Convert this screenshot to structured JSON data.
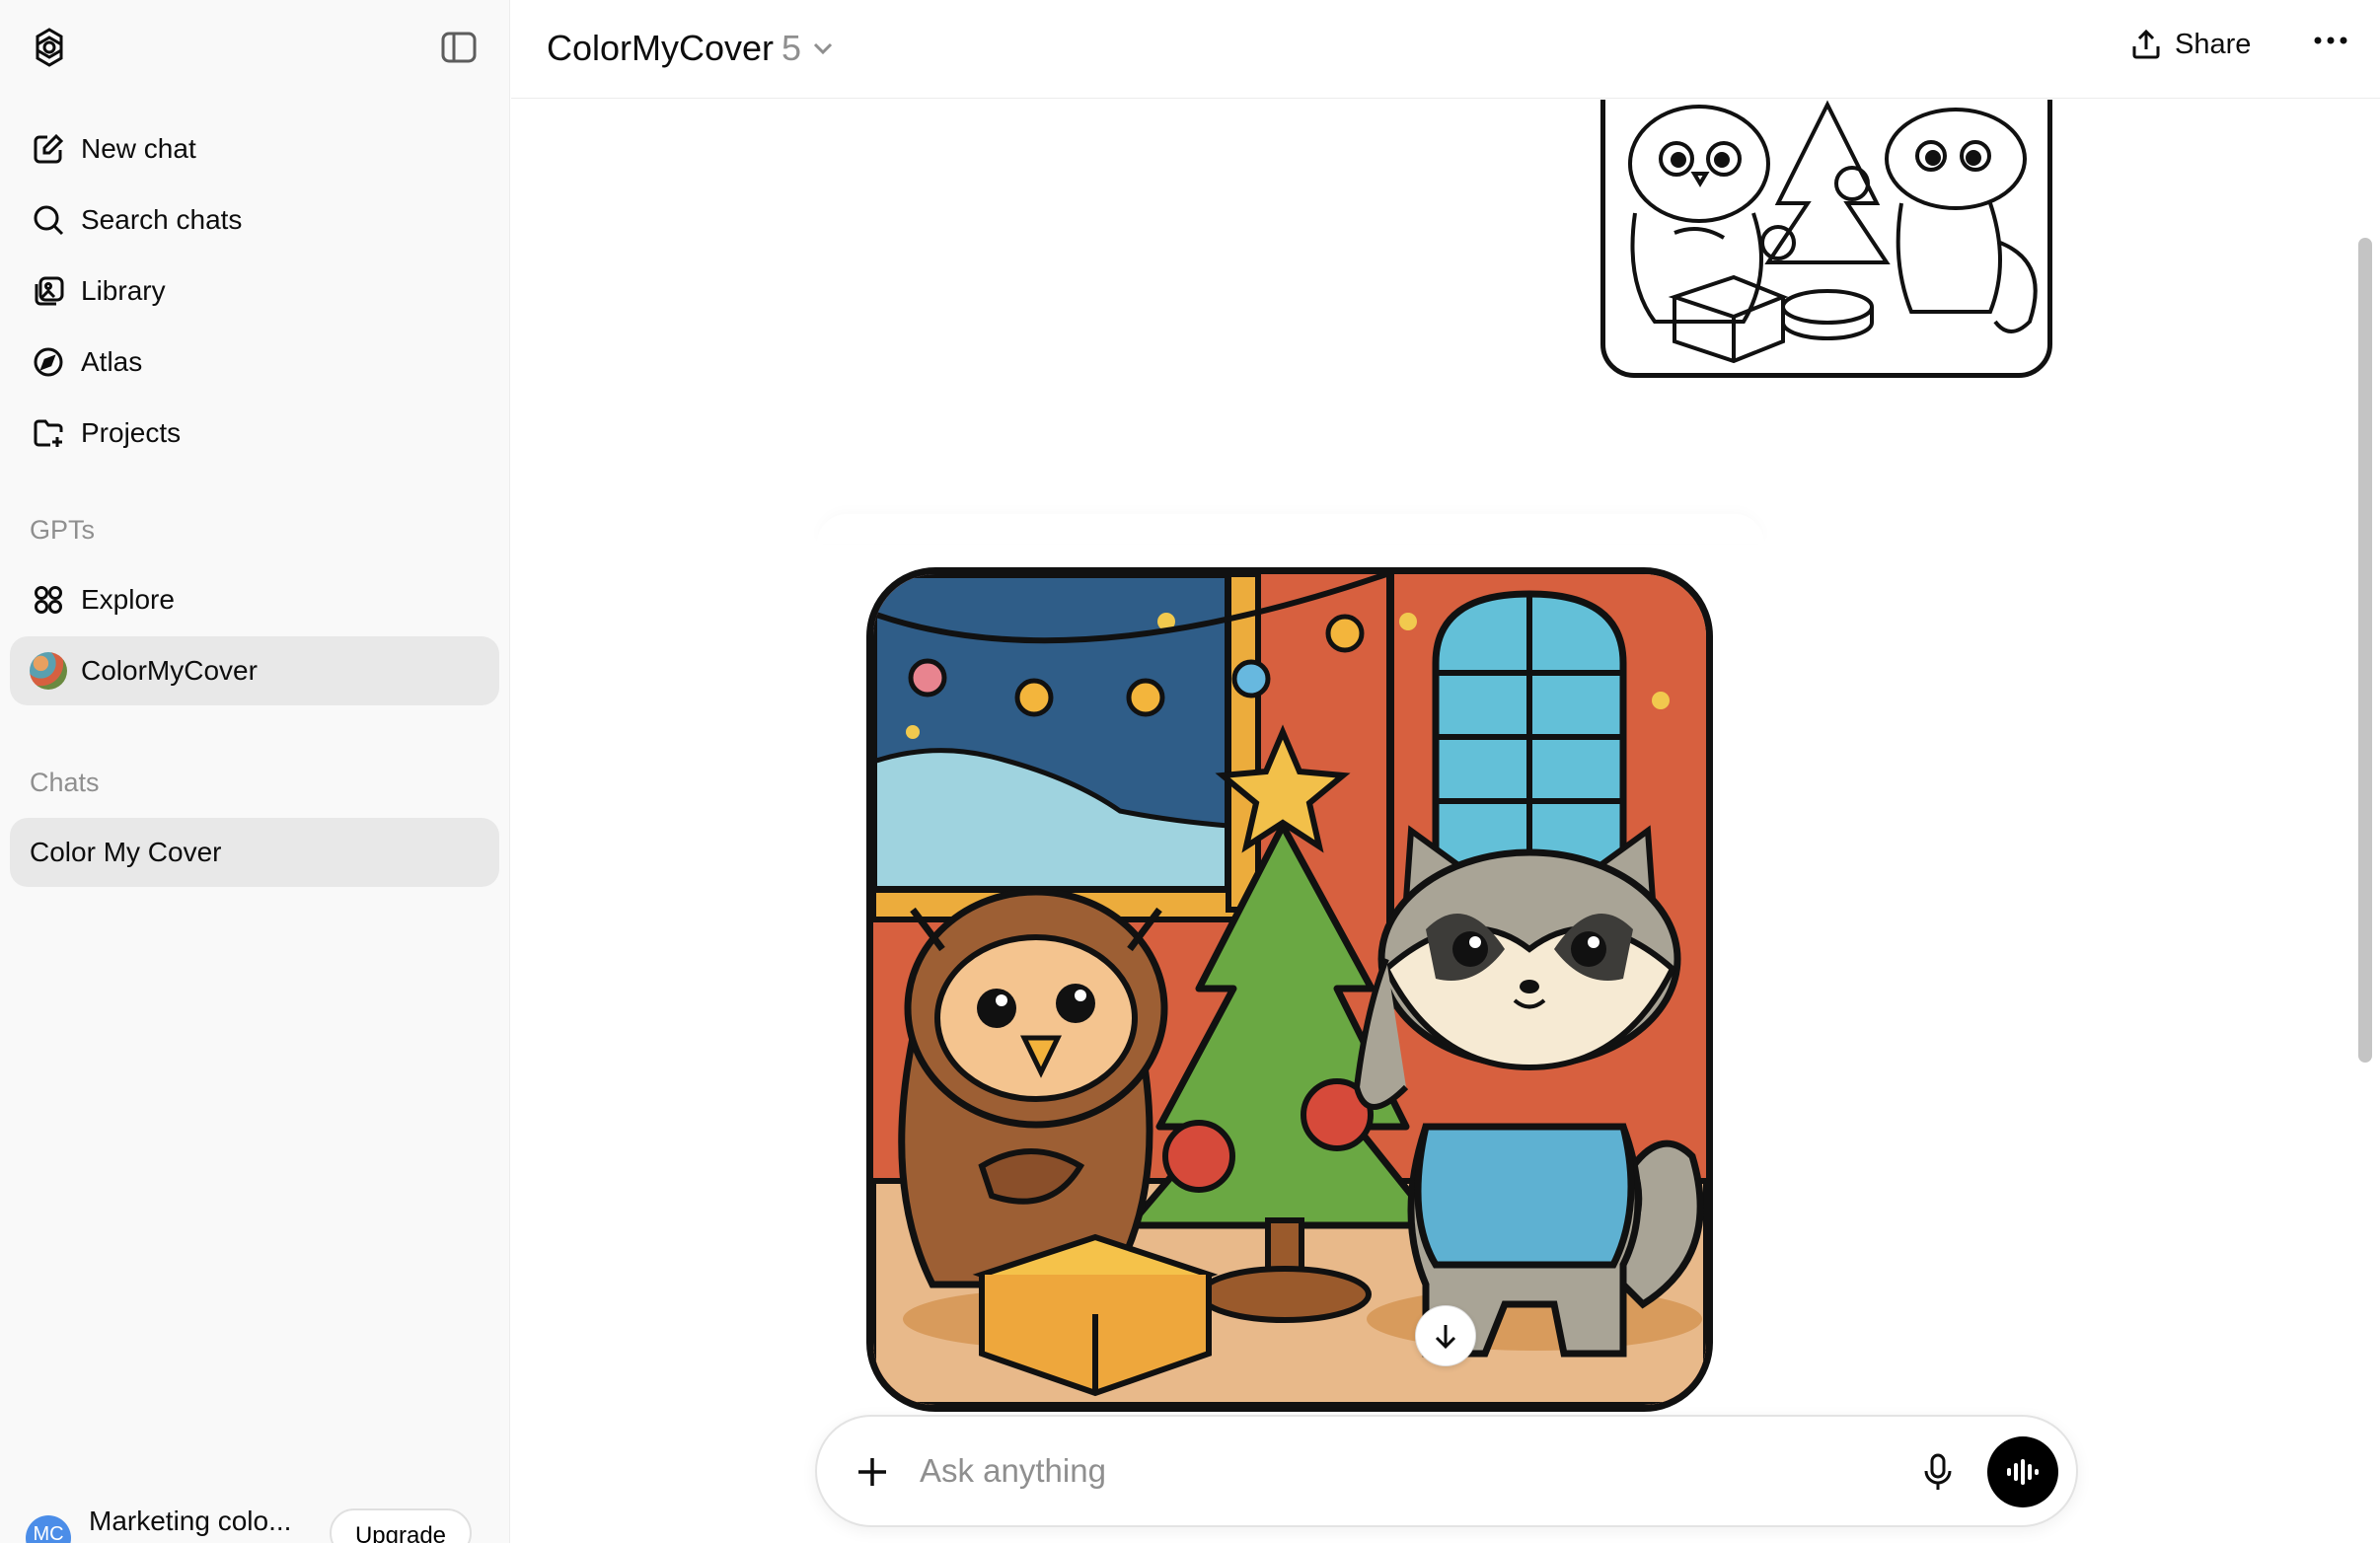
{
  "sidebar": {
    "nav": [
      {
        "label": "New chat",
        "icon": "edit-icon"
      },
      {
        "label": "Search chats",
        "icon": "search-icon"
      },
      {
        "label": "Library",
        "icon": "library-icon"
      },
      {
        "label": "Atlas",
        "icon": "compass-icon"
      },
      {
        "label": "Projects",
        "icon": "folder-plus-icon"
      }
    ],
    "gpts_label": "GPTs",
    "gpts": [
      {
        "label": "Explore",
        "icon": "grid-icon"
      },
      {
        "label": "ColorMyCover",
        "icon": "gpt-avatar"
      }
    ],
    "chats_label": "Chats",
    "chats": [
      {
        "label": "Color My Cover"
      }
    ],
    "user": {
      "initials": "MC",
      "name": "Marketing colo...",
      "upgrade_label": "Upgrade"
    }
  },
  "header": {
    "title": "ColorMyCover",
    "version": "5",
    "share_label": "Share"
  },
  "composer": {
    "placeholder": "Ask anything"
  },
  "colors": {
    "accent": "#000000",
    "sidebar_bg": "#f9f9f9",
    "active_item": "#e8e8e8",
    "avatar": "#4b8de8"
  }
}
